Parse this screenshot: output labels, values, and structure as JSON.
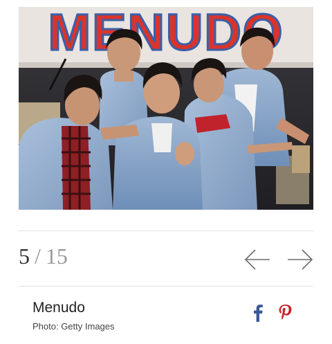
{
  "gallery": {
    "image_alt": "Menudo",
    "banner_text": "MENUDO",
    "counter": {
      "current": "5",
      "separator": "/",
      "total": "15"
    },
    "caption": {
      "title": "Menudo",
      "credit": "Photo: Getty Images"
    }
  },
  "navigation": {
    "prev_icon": "arrow-left-icon",
    "next_icon": "arrow-right-icon"
  },
  "share": {
    "facebook_icon": "facebook-icon",
    "pinterest_icon": "pinterest-icon"
  },
  "colors": {
    "banner_red": "#d9342b",
    "banner_blue": "#3a5fa8",
    "denim": "#8aa6c8",
    "text_dark": "#222222",
    "text_muted": "#9a9a9a",
    "arrow_gray": "#6b6b6b",
    "facebook_blue": "#3b5998",
    "pinterest_red": "#c8232c"
  }
}
